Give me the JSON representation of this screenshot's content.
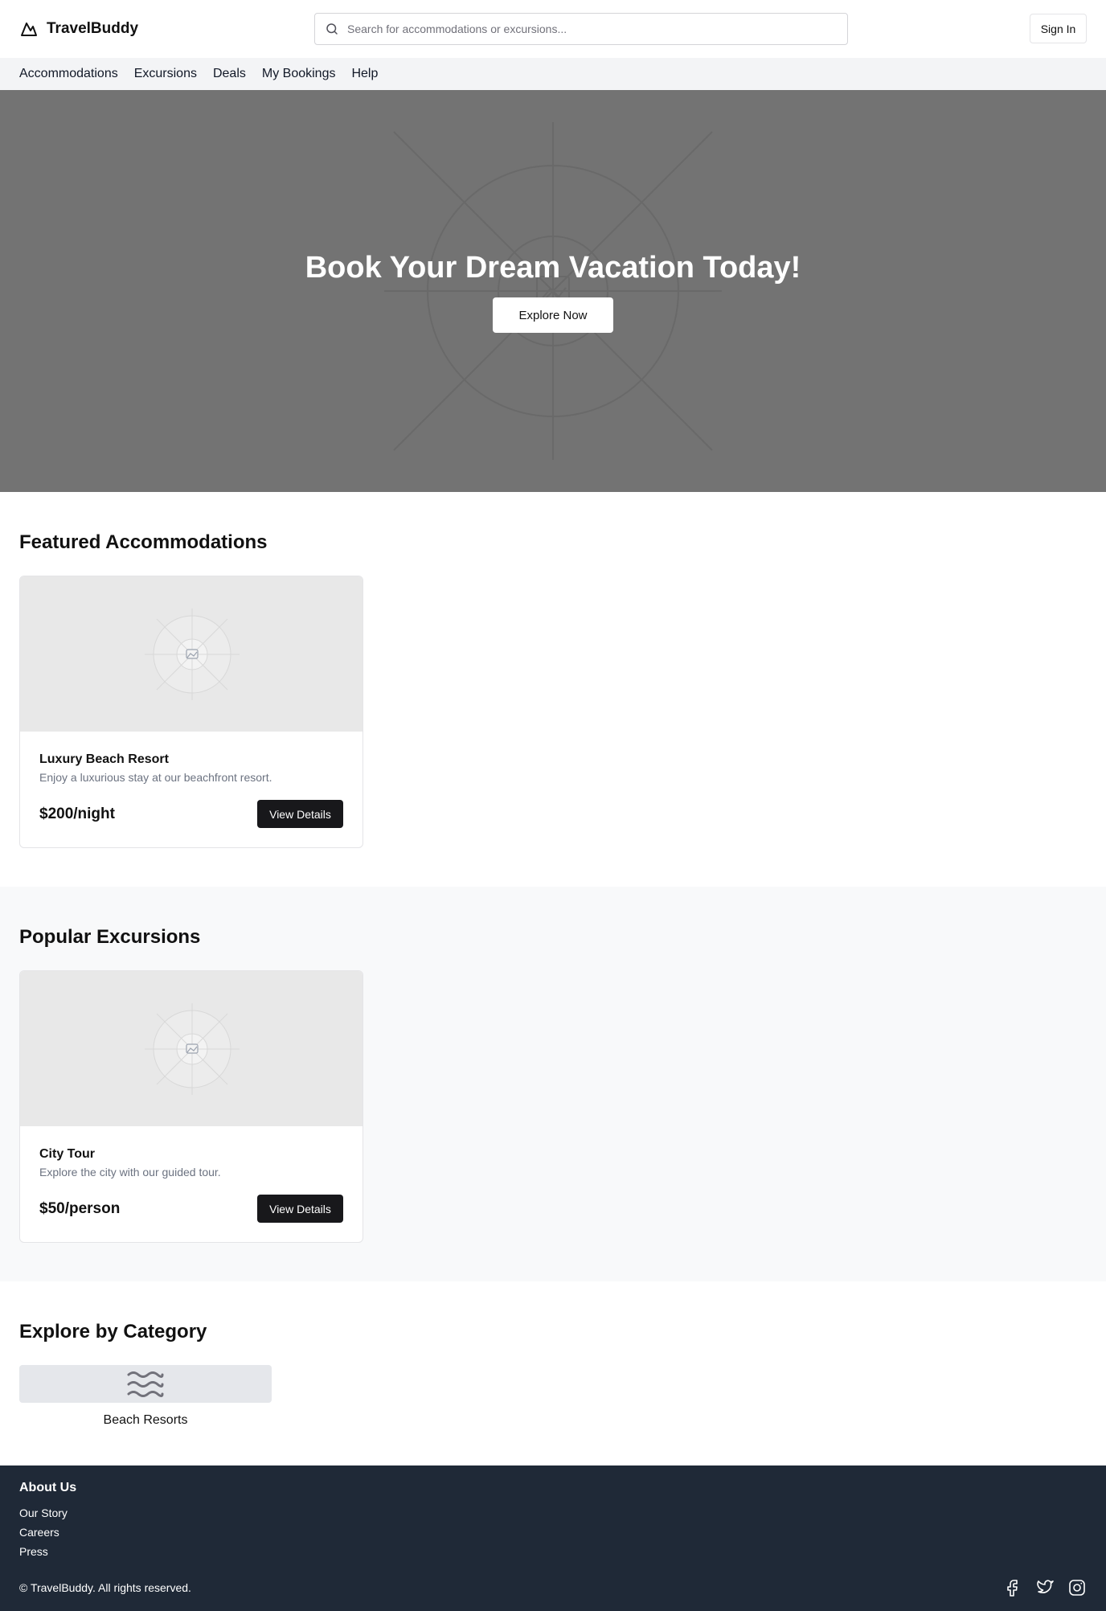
{
  "header": {
    "brand": "TravelBuddy",
    "search_placeholder": "Search for accommodations or excursions...",
    "signin_label": "Sign In"
  },
  "nav": {
    "items": [
      {
        "label": "Accommodations"
      },
      {
        "label": "Excursions"
      },
      {
        "label": "Deals"
      },
      {
        "label": "My Bookings"
      },
      {
        "label": "Help"
      }
    ]
  },
  "hero": {
    "title": "Book Your Dream Vacation Today!",
    "button": "Explore Now"
  },
  "featured": {
    "title": "Featured Accommodations",
    "cards": [
      {
        "title": "Luxury Beach Resort",
        "description": "Enjoy a luxurious stay at our beachfront resort.",
        "price": "$200/night",
        "button": "View Details"
      }
    ]
  },
  "excursions": {
    "title": "Popular Excursions",
    "cards": [
      {
        "title": "City Tour",
        "description": "Explore the city with our guided tour.",
        "price": "$50/person",
        "button": "View Details"
      }
    ]
  },
  "categories": {
    "title": "Explore by Category",
    "items": [
      {
        "label": "Beach Resorts",
        "icon": "waves-icon"
      }
    ]
  },
  "footer": {
    "heading": "About Us",
    "links": [
      "Our Story",
      "Careers",
      "Press"
    ],
    "copyright": "© TravelBuddy. All rights reserved.",
    "social": [
      "facebook-icon",
      "twitter-icon",
      "instagram-icon"
    ]
  },
  "colors": {
    "footer_bg": "#1f2937",
    "hero_bg": "#737373",
    "nav_bg": "#f3f4f6",
    "button_dark": "#18181b"
  }
}
